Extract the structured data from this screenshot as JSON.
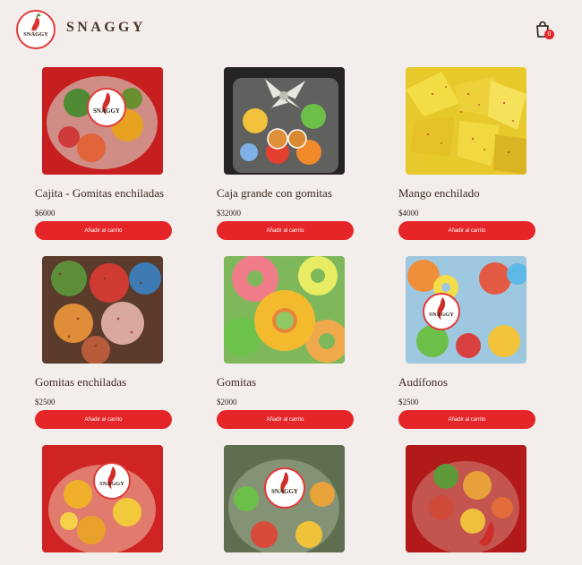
{
  "header": {
    "brand": "SNAGGY",
    "logo_text": "SNAGGY",
    "cart_count": "0"
  },
  "colors": {
    "background": "#f3eeec",
    "accent": "#e52528",
    "text": "#3b2a22"
  },
  "products": [
    {
      "name": "Cajita - Gomitas enchiladas",
      "price": "$6000",
      "button": "Añadir al carrito",
      "image": "sticker-box-red"
    },
    {
      "name": "Caja grande con gomitas",
      "price": "$32000",
      "button": "Añadir al carrito",
      "image": "gift-box-bow"
    },
    {
      "name": "Mango enchilado",
      "price": "$4000",
      "button": "Añadir al carrito",
      "image": "mango-chili"
    },
    {
      "name": "Gomitas enchiladas",
      "price": "$2500",
      "button": "Añadir al carrito",
      "image": "chili-gummies-closeup"
    },
    {
      "name": "Gomitas",
      "price": "$2000",
      "button": "Añadir al carrito",
      "image": "peach-rings"
    },
    {
      "name": "Audífonos",
      "price": "$2500",
      "button": "Añadir al carrito",
      "image": "gummy-bags"
    },
    {
      "name": "",
      "price": "",
      "button": "",
      "image": "fruit-cup-sticker"
    },
    {
      "name": "",
      "price": "",
      "button": "",
      "image": "gummy-cup-sticker"
    },
    {
      "name": "",
      "price": "",
      "button": "",
      "image": "mixed-cup-red"
    }
  ]
}
